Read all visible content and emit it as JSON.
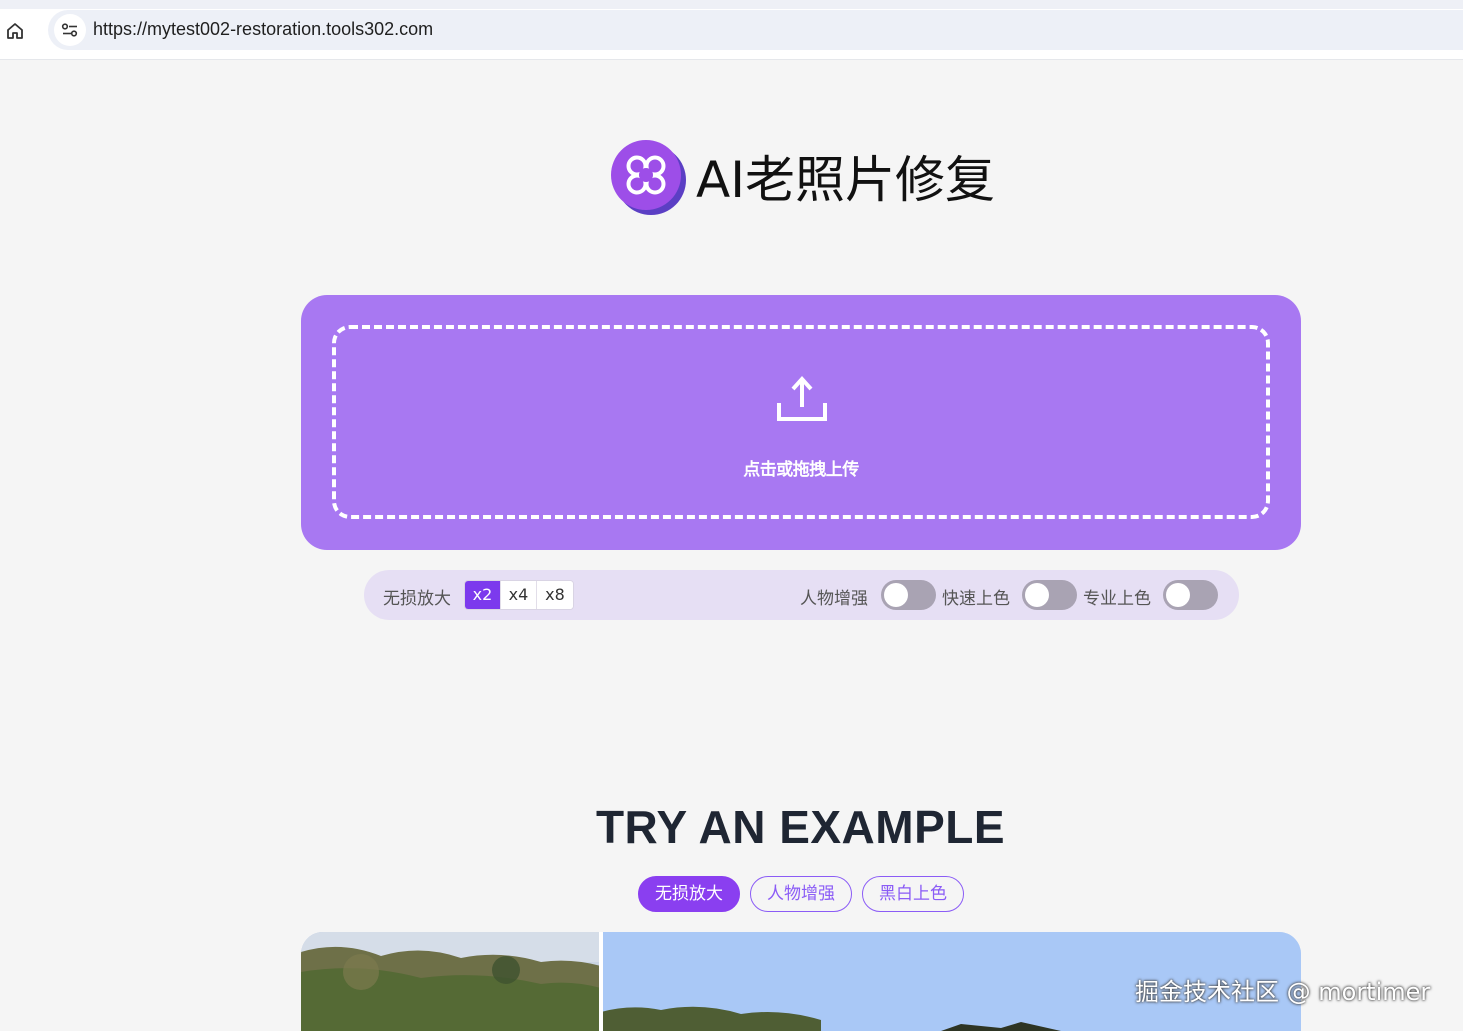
{
  "browser": {
    "url": "https://mytest002-restoration.tools302.com",
    "home_icon": "home-icon",
    "site_info_icon": "tune-icon"
  },
  "header": {
    "title": "AI老照片修复",
    "logo_icon": "clover-logo-icon"
  },
  "upload": {
    "label": "点击或拖拽上传",
    "icon": "upload-icon"
  },
  "options": {
    "upscale_label": "无损放大",
    "scales": [
      "x2",
      "x4",
      "x8"
    ],
    "selected_scale": "x2",
    "toggles": [
      {
        "label": "人物增强",
        "on": false
      },
      {
        "label": "快速上色",
        "on": false
      },
      {
        "label": "专业上色",
        "on": false
      }
    ]
  },
  "examples": {
    "title": "TRY AN EXAMPLE",
    "tabs": [
      "无损放大",
      "人物增强",
      "黑白上色"
    ],
    "active_tab": "无损放大"
  },
  "watermark": "掘金技术社区 @ mortimer",
  "colors": {
    "accent": "#7c3aed",
    "upload_bg": "#a878f2",
    "options_bg": "#e6dff4",
    "tab_active": "#8a3ff0"
  }
}
